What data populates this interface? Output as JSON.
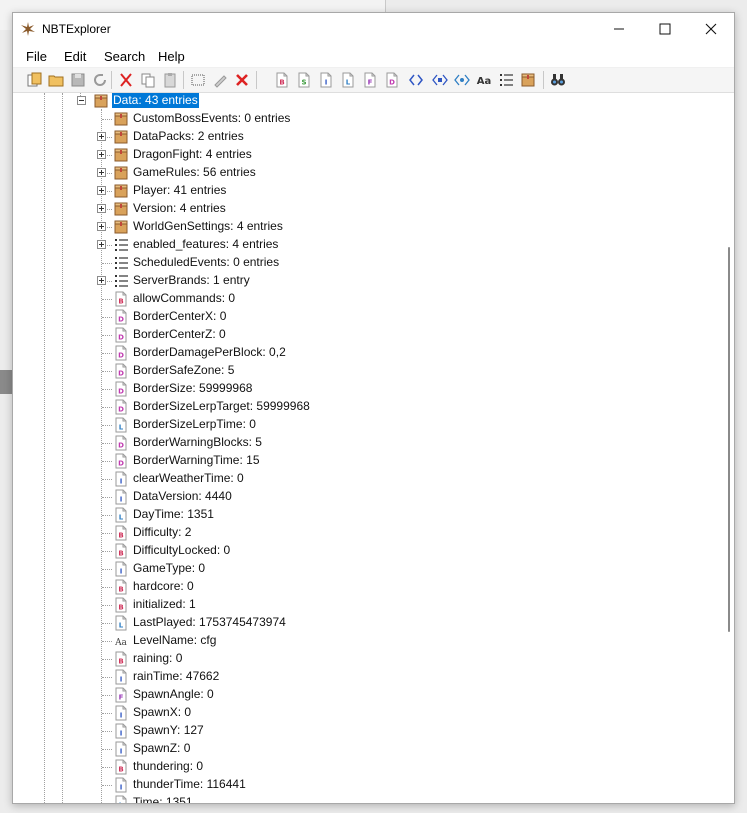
{
  "window": {
    "title": "NBTExplorer",
    "icon": "nbtexplorer-logo-icon"
  },
  "menu": [
    "File",
    "Edit",
    "Search",
    "Help"
  ],
  "toolbar_icons": [
    "open-file-icon",
    "open-folder-icon",
    "save-icon",
    "refresh-icon",
    "cut-icon",
    "copy-icon",
    "paste-icon",
    "rename-icon",
    "edit-icon",
    "delete-icon",
    "add-byte-icon",
    "add-short-icon",
    "add-int-icon",
    "add-long-icon",
    "add-float-icon",
    "add-double-icon",
    "add-byte-array-icon",
    "add-int-array-icon",
    "add-long-array-icon",
    "add-string-icon",
    "add-list-icon",
    "add-compound-icon",
    "find-icon"
  ],
  "tree": {
    "selected": "Data: 43 entries",
    "children": [
      {
        "label": "CustomBossEvents: 0 entries",
        "type": "compound",
        "expandable": false
      },
      {
        "label": "DataPacks: 2 entries",
        "type": "compound",
        "expandable": true
      },
      {
        "label": "DragonFight: 4 entries",
        "type": "compound",
        "expandable": true
      },
      {
        "label": "GameRules: 56 entries",
        "type": "compound",
        "expandable": true
      },
      {
        "label": "Player: 41 entries",
        "type": "compound",
        "expandable": true
      },
      {
        "label": "Version: 4 entries",
        "type": "compound",
        "expandable": true
      },
      {
        "label": "WorldGenSettings: 4 entries",
        "type": "compound",
        "expandable": true
      },
      {
        "label": "enabled_features: 4 entries",
        "type": "list",
        "expandable": true
      },
      {
        "label": "ScheduledEvents: 0 entries",
        "type": "list",
        "expandable": false
      },
      {
        "label": "ServerBrands: 1 entry",
        "type": "list",
        "expandable": true
      },
      {
        "label": "allowCommands: 0",
        "type": "byte",
        "expandable": false
      },
      {
        "label": "BorderCenterX: 0",
        "type": "double",
        "expandable": false
      },
      {
        "label": "BorderCenterZ: 0",
        "type": "double",
        "expandable": false
      },
      {
        "label": "BorderDamagePerBlock: 0,2",
        "type": "double",
        "expandable": false
      },
      {
        "label": "BorderSafeZone: 5",
        "type": "double",
        "expandable": false
      },
      {
        "label": "BorderSize: 59999968",
        "type": "double",
        "expandable": false
      },
      {
        "label": "BorderSizeLerpTarget: 59999968",
        "type": "double",
        "expandable": false
      },
      {
        "label": "BorderSizeLerpTime: 0",
        "type": "long",
        "expandable": false
      },
      {
        "label": "BorderWarningBlocks: 5",
        "type": "double",
        "expandable": false
      },
      {
        "label": "BorderWarningTime: 15",
        "type": "double",
        "expandable": false
      },
      {
        "label": "clearWeatherTime: 0",
        "type": "int",
        "expandable": false
      },
      {
        "label": "DataVersion: 4440",
        "type": "int",
        "expandable": false
      },
      {
        "label": "DayTime: 1351",
        "type": "long",
        "expandable": false
      },
      {
        "label": "Difficulty: 2",
        "type": "byte",
        "expandable": false
      },
      {
        "label": "DifficultyLocked: 0",
        "type": "byte",
        "expandable": false
      },
      {
        "label": "GameType: 0",
        "type": "int",
        "expandable": false
      },
      {
        "label": "hardcore: 0",
        "type": "byte",
        "expandable": false
      },
      {
        "label": "initialized: 1",
        "type": "byte",
        "expandable": false
      },
      {
        "label": "LastPlayed: 1753745473974",
        "type": "long",
        "expandable": false
      },
      {
        "label": "LevelName: cfg",
        "type": "string",
        "expandable": false
      },
      {
        "label": "raining: 0",
        "type": "byte",
        "expandable": false
      },
      {
        "label": "rainTime: 47662",
        "type": "int",
        "expandable": false
      },
      {
        "label": "SpawnAngle: 0",
        "type": "float",
        "expandable": false
      },
      {
        "label": "SpawnX: 0",
        "type": "int",
        "expandable": false
      },
      {
        "label": "SpawnY: 127",
        "type": "int",
        "expandable": false
      },
      {
        "label": "SpawnZ: 0",
        "type": "int",
        "expandable": false
      },
      {
        "label": "thundering: 0",
        "type": "byte",
        "expandable": false
      },
      {
        "label": "thunderTime: 116441",
        "type": "int",
        "expandable": false
      },
      {
        "label": "Time: 1351",
        "type": "long",
        "expandable": false
      }
    ]
  },
  "type_letters": {
    "byte": "B",
    "short": "S",
    "int": "I",
    "long": "L",
    "float": "F",
    "double": "D",
    "string": "Aa"
  },
  "type_colors": {
    "byte": "#d0335b",
    "short": "#3a9a3a",
    "int": "#2f56c4",
    "long": "#2f7fc4",
    "float": "#9a3ab8",
    "double": "#c03ab0",
    "string": "#444444"
  },
  "accent": "#0078d7"
}
